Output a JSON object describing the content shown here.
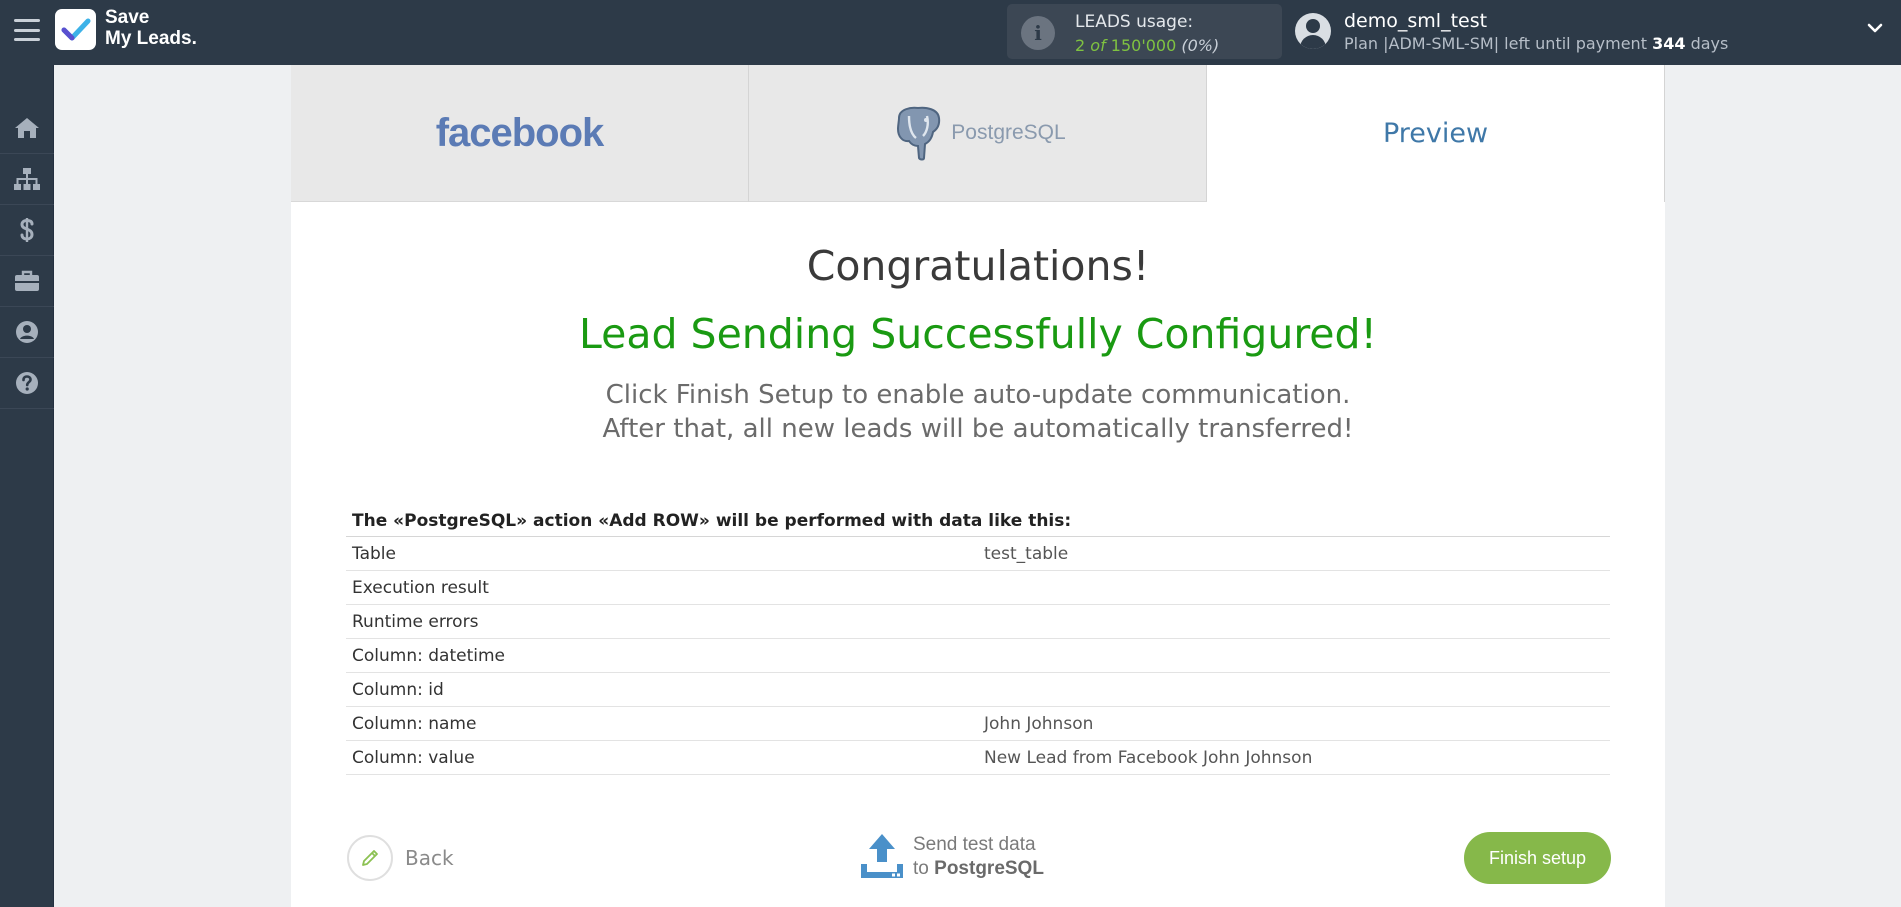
{
  "app": {
    "logo_line1": "Save",
    "logo_line2": "My Leads."
  },
  "usage": {
    "label": "LEADS usage:",
    "used": "2",
    "of": "of",
    "total": "150'000",
    "percent": "(0%)"
  },
  "user": {
    "name": "demo_sml_test",
    "plan_prefix": "Plan |ADM-SML-SM| left until payment",
    "days": "344",
    "days_suffix": "days"
  },
  "tabs": {
    "source_logo": "facebook",
    "destination_logo": "PostgreSQL",
    "preview": "Preview"
  },
  "main": {
    "congrats": "Congratulations!",
    "success": "Lead Sending Successfully Configured!",
    "instr_line1": "Click Finish Setup to enable auto-update communication.",
    "instr_line2": "After that, all new leads will be automatically transferred!"
  },
  "table": {
    "title": "The «PostgreSQL» action «Add ROW» will be performed with data like this:",
    "rows": [
      {
        "key": "Table",
        "value": "test_table"
      },
      {
        "key": "Execution result",
        "value": ""
      },
      {
        "key": "Runtime errors",
        "value": ""
      },
      {
        "key": "Column: datetime",
        "value": ""
      },
      {
        "key": "Column: id",
        "value": ""
      },
      {
        "key": "Column: name",
        "value": "John Johnson"
      },
      {
        "key": "Column: value",
        "value": "New Lead from Facebook John Johnson"
      }
    ]
  },
  "actions": {
    "back": "Back",
    "send_line1": "Send test data",
    "send_line2_prefix": "to",
    "send_line2_target": "PostgreSQL",
    "finish": "Finish setup"
  },
  "colors": {
    "topbar": "#2d3a48",
    "accent_green": "#86b84a",
    "success_green": "#1a9a12",
    "link_blue": "#3f78a8"
  },
  "icons": {
    "menu": "hamburger-icon",
    "usage": "info-icon",
    "user": "user-avatar-icon",
    "dropdown": "chevron-down-icon",
    "sidebar": [
      "home-icon",
      "sitemap-icon",
      "dollar-icon",
      "briefcase-icon",
      "user-circle-icon",
      "help-icon"
    ],
    "back": "pencil-icon",
    "send": "upload-icon"
  }
}
